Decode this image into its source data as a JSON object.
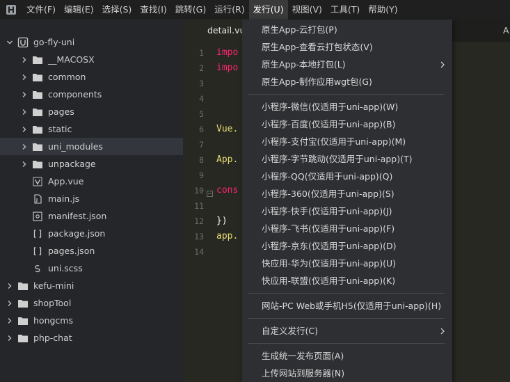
{
  "menubar": {
    "items": [
      "文件(F)",
      "编辑(E)",
      "选择(S)",
      "查找(I)",
      "跳转(G)",
      "运行(R)",
      "发行(U)",
      "视图(V)",
      "工具(T)",
      "帮助(Y)"
    ],
    "active_index": 6
  },
  "sidebar": {
    "items": [
      {
        "label": "go-fly-uni",
        "type": "project",
        "expanded": true
      },
      {
        "label": "__MACOSX",
        "type": "folder"
      },
      {
        "label": "common",
        "type": "folder"
      },
      {
        "label": "components",
        "type": "folder"
      },
      {
        "label": "pages",
        "type": "folder"
      },
      {
        "label": "static",
        "type": "folder"
      },
      {
        "label": "uni_modules",
        "type": "folder",
        "selected": true
      },
      {
        "label": "unpackage",
        "type": "folder"
      },
      {
        "label": "App.vue",
        "type": "vue-file"
      },
      {
        "label": "main.js",
        "type": "js-file"
      },
      {
        "label": "manifest.json",
        "type": "manifest-file"
      },
      {
        "label": "package.json",
        "type": "json-file"
      },
      {
        "label": "pages.json",
        "type": "json-file"
      },
      {
        "label": "uni.scss",
        "type": "scss-file"
      },
      {
        "label": "kefu-mini",
        "type": "project-folder"
      },
      {
        "label": "shopTool",
        "type": "project-folder"
      },
      {
        "label": "hongcms",
        "type": "project-folder"
      },
      {
        "label": "php-chat",
        "type": "project-folder"
      }
    ]
  },
  "editor": {
    "active_tab": "detail.vue",
    "right_tab_partial": "A",
    "lines": [
      {
        "num": "1",
        "text": "impo",
        "cls": "kw"
      },
      {
        "num": "2",
        "text": "impo",
        "cls": "kw"
      },
      {
        "num": "3",
        "text": "",
        "cls": "plain"
      },
      {
        "num": "4",
        "text": "",
        "cls": "plain"
      },
      {
        "num": "5",
        "text": "",
        "cls": "plain"
      },
      {
        "num": "6",
        "text": "Vue.",
        "cls": "fn"
      },
      {
        "num": "7",
        "text": "",
        "cls": "plain"
      },
      {
        "num": "8",
        "text": "App.",
        "cls": "fn"
      },
      {
        "num": "9",
        "text": "",
        "cls": "plain"
      },
      {
        "num": "10",
        "text": "cons",
        "cls": "kw",
        "fold": true
      },
      {
        "num": "11",
        "text": "",
        "cls": "plain"
      },
      {
        "num": "12",
        "text": "})",
        "cls": "plain"
      },
      {
        "num": "13",
        "text": "app.",
        "cls": "fn"
      },
      {
        "num": "14",
        "text": "",
        "cls": "plain"
      }
    ]
  },
  "release_menu": {
    "groups": [
      [
        "原生App-云打包(P)",
        "原生App-查看云打包状态(V)",
        "原生App-本地打包(L)",
        "原生App-制作应用wgt包(G)"
      ],
      [
        "小程序-微信(仅适用于uni-app)(W)",
        "小程序-百度(仅适用于uni-app)(B)",
        "小程序-支付宝(仅适用于uni-app)(M)",
        "小程序-字节跳动(仅适用于uni-app)(T)",
        "小程序-QQ(仅适用于uni-app)(Q)",
        "小程序-360(仅适用于uni-app)(S)",
        "小程序-快手(仅适用于uni-app)(J)",
        "小程序-飞书(仅适用于uni-app)(F)",
        "小程序-京东(仅适用于uni-app)(D)",
        "快应用-华为(仅适用于uni-app)(U)",
        "快应用-联盟(仅适用于uni-app)(K)"
      ],
      [
        "网站-PC Web或手机H5(仅适用于uni-app)(H)"
      ],
      [
        "自定义发行(C)"
      ],
      [
        "生成统一发布页面(A)",
        "上传网站到服务器(N)"
      ]
    ],
    "submenu_items": [
      "原生App-本地打包(L)",
      "自定义发行(C)"
    ]
  },
  "colors": {
    "menubar_bg": "#1f1f1f",
    "sidebar_bg": "#25262a",
    "editor_bg": "#272822",
    "dropdown_bg": "#2e2f33",
    "keyword": "#f92672",
    "function": "#e6db74"
  }
}
